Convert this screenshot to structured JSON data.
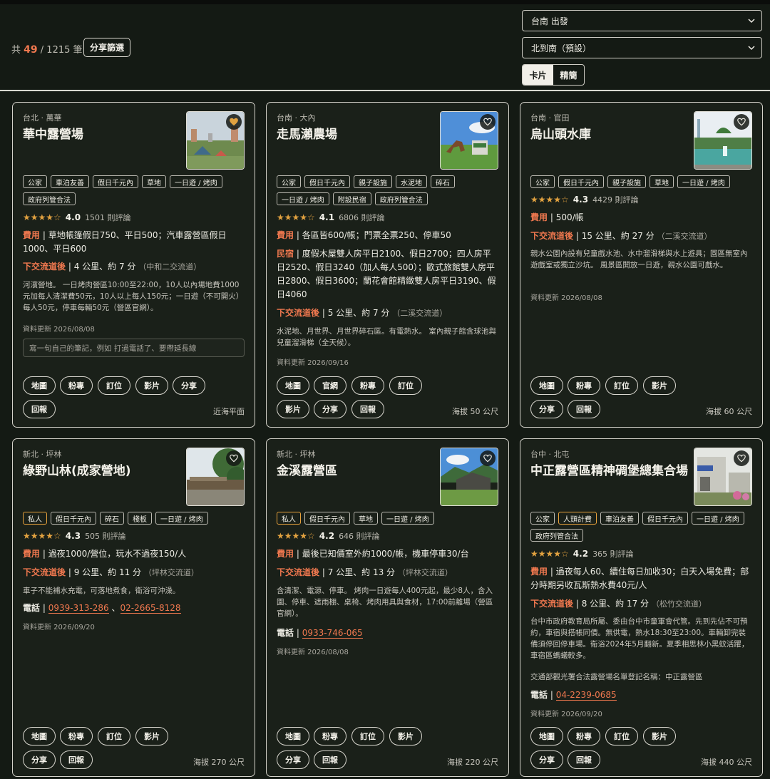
{
  "header": {
    "count_prefix": "共",
    "count_shown": "49",
    "count_total": "/ 1215 筆",
    "share_filter": "分享篩選",
    "origin_select": "台南 出發",
    "order_select": "北到南（預設）",
    "view_card": "卡片",
    "view_compact": "精簡"
  },
  "labels": {
    "fee": "費用",
    "exit": "下交流道後",
    "bnb": "民宿",
    "phone": "電話",
    "note_placeholder": "寫一句自己的筆記，例如 打過電話了、要帶延長線"
  },
  "colors": {
    "accent": "#f0784f",
    "star": "#e2a240",
    "border": "#d4d2ca",
    "background": "#141a14"
  },
  "cards": [
    {
      "region": "台北 · 萬華",
      "name": "華中露營場",
      "favorited": true,
      "tags": [
        "公家",
        "車泊友善",
        "假日千元內",
        "草地",
        "一日遊 / 烤肉",
        "政府列管合法"
      ],
      "stars": "★★★★☆",
      "rating": "4.0",
      "reviews": "1501 則評論",
      "fee": "草地帳篷假日750、平日500；汽車露營區假日1000、平日600",
      "exit": "4 公里、約 7 分",
      "exit_note": "（中和二交流道）",
      "desc": "河濱營地。 一日烤肉營區10:00至22:00，10人以內場地費1000元加每人清潔費50元，10人以上每人150元；一日遊（不可開火）每人50元，停車每輛50元（營區官網）。",
      "updated": "資料更新 2026/08/08",
      "buttons": [
        "地圖",
        "粉專",
        "訂位",
        "影片",
        "分享",
        "回報"
      ],
      "footer": "近海平面"
    },
    {
      "region": "台南 · 大內",
      "name": "走馬瀨農場",
      "favorited": false,
      "tags": [
        "公家",
        "假日千元內",
        "親子設施",
        "水泥地",
        "碎石",
        "一日遊 / 烤肉",
        "附設民宿",
        "政府列管合法"
      ],
      "stars": "★★★★☆",
      "rating": "4.1",
      "reviews": "6806 則評論",
      "fee": "各區皆600/帳；門票全票250、停車50",
      "bnb": "度假木屋雙人房平日2100、假日2700；四人房平日2520、假日3240（加人每人500）；歐式旅館雙人房平日2800、假日3600；蘭花會館精緻雙人房平日3190、假日4060",
      "exit": "5 公里、約 7 分",
      "exit_note": "（二溪交流道）",
      "desc": "水泥地、月世界、月世界碎石區。有電熱水。 室內親子館含球池與兒童溜滑梯（全天候）。",
      "updated": "資料更新 2026/09/16",
      "buttons": [
        "地圖",
        "官網",
        "粉專",
        "訂位",
        "影片",
        "分享",
        "回報"
      ],
      "footer": "海拔 50 公尺"
    },
    {
      "region": "台南 · 官田",
      "name": "烏山頭水庫",
      "favorited": false,
      "tags": [
        "公家",
        "假日千元內",
        "親子設施",
        "草地",
        "一日遊 / 烤肉"
      ],
      "stars": "★★★★☆",
      "rating": "4.3",
      "reviews": "4429 則評論",
      "fee": "500/帳",
      "exit": "15 公里、約 27 分",
      "exit_note": "（二溪交流道）",
      "desc": "親水公園內設有兒童戲水池、水中溜滑梯與水上遊具；園區無室內遊戲室或獨立沙坑。 風景區開放一日遊，親水公園可戲水。",
      "updated": "資料更新 2026/08/08",
      "buttons": [
        "地圖",
        "粉專",
        "訂位",
        "影片",
        "分享",
        "回報"
      ],
      "footer": "海拔 60 公尺"
    },
    {
      "region": "新北 · 坪林",
      "name": "綠野山林(成家營地)",
      "favorited": false,
      "tags": [
        "私人",
        "假日千元內",
        "碎石",
        "棧板",
        "一日遊 / 烤肉"
      ],
      "stars": "★★★★☆",
      "rating": "4.3",
      "reviews": "505 則評論",
      "fee": "過夜1000/營位，玩水不過夜150/人",
      "exit": "9 公里、約 11 分",
      "exit_note": "（坪林交流道）",
      "desc": "車子不能補水充電，可落地煮食，衛浴可沖澡。",
      "phones": [
        "0939-313-286",
        "02-2665-8128"
      ],
      "updated": "資料更新 2026/09/20",
      "buttons": [
        "地圖",
        "粉專",
        "訂位",
        "影片",
        "分享",
        "回報"
      ],
      "footer": "海拔 270 公尺"
    },
    {
      "region": "新北 · 坪林",
      "name": "金溪露營區",
      "favorited": false,
      "tags": [
        "私人",
        "假日千元內",
        "草地",
        "一日遊 / 烤肉"
      ],
      "stars": "★★★★☆",
      "rating": "4.2",
      "reviews": "646 則評論",
      "fee": "最後已知價室外約1000/帳，機車停車30/台",
      "exit": "7 公里、約 13 分",
      "exit_note": "（坪林交流道）",
      "desc": "含清潔、電源、停車。 烤肉一日遊每人400元起，最少8人，含入園、停車、遮雨棚、桌椅、烤肉用具與食材，17:00前離場（營區官網）。",
      "phones": [
        "0933-746-065"
      ],
      "updated": "資料更新 2026/08/08",
      "buttons": [
        "地圖",
        "粉專",
        "訂位",
        "影片",
        "分享",
        "回報"
      ],
      "footer": "海拔 220 公尺"
    },
    {
      "region": "台中 · 北屯",
      "name": "中正露營區精神碉堡總集合場",
      "favorited": false,
      "tags": [
        "公家",
        "人頭計費",
        "車泊友善",
        "假日千元內",
        "一日遊 / 烤肉",
        "政府列管合法"
      ],
      "stars": "★★★★☆",
      "rating": "4.2",
      "reviews": "365 則評論",
      "fee": "過夜每人60、續住每日加收30；白天入場免費；部分時期另收瓦斯熱水費40元/人",
      "exit": "8 公里、約 17 分",
      "exit_note": "（松竹交流道）",
      "desc": "台中市政府教育局所屬、委由台中市童軍會代管。先到先佔不可預約，車宿與搭帳同價。無供電，熱水18:30至23:00。車輛卸完裝備須停回停車場。衛浴2024年5月翻新。夏季相思林小黑蚊活躍，車宿區螞蟻較多。",
      "desc2": "交通部觀光署合法露營場名單登記名稱：中正露營區",
      "phones": [
        "04-2239-0685"
      ],
      "updated": "資料更新 2026/09/20",
      "buttons": [
        "地圖",
        "粉專",
        "訂位",
        "影片",
        "分享",
        "回報"
      ],
      "footer": "海拔 440 公尺"
    }
  ]
}
